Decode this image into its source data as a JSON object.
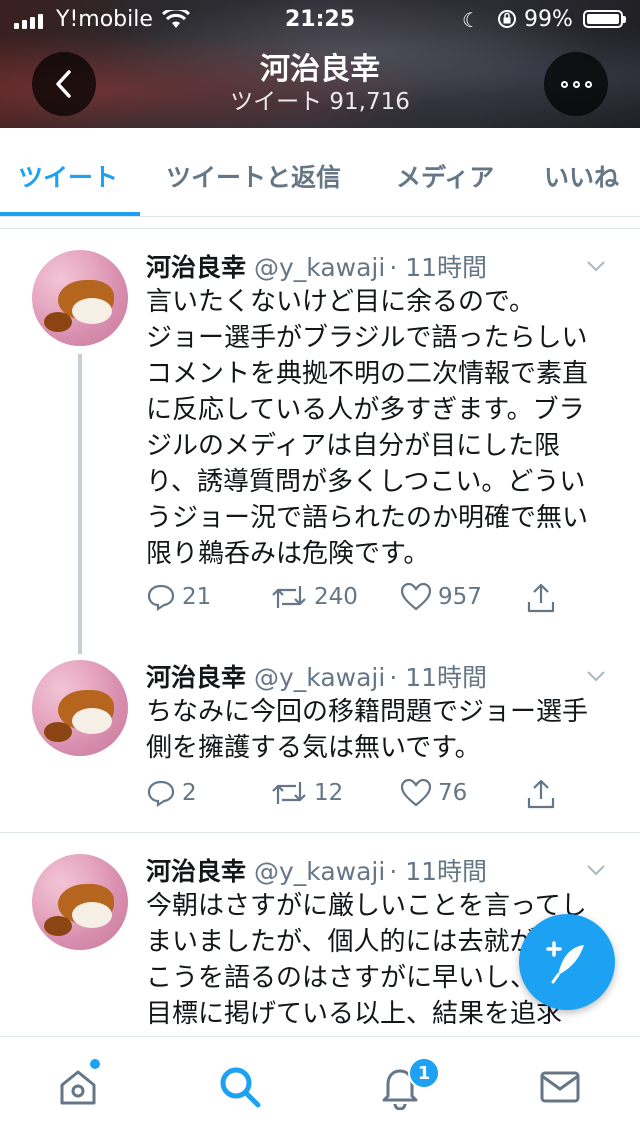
{
  "status_bar": {
    "carrier": "Y!mobile",
    "time": "21:25",
    "battery": "99%"
  },
  "header": {
    "title": "河治良幸",
    "subtitle": "ツイート 91,716"
  },
  "tabs": [
    {
      "label": "ツイート",
      "active": true
    },
    {
      "label": "ツイートと返信",
      "active": false
    },
    {
      "label": "メディア",
      "active": false
    },
    {
      "label": "いいね",
      "active": false
    }
  ],
  "tweets": [
    {
      "name": "河治良幸",
      "handle": "@y_kawaji",
      "time": "· 11時間",
      "text": "言いたくないけど目に余るので。\nジョー選手がブラジルで語ったらしいコメントを典拠不明の二次情報で素直に反応している人が多すぎます。ブラジルのメディアは自分が目にした限り、誘導質問が多くしつこい。どういうジョー況で語られたのか明確で無い限り鵜呑みは危険です。",
      "replies": "21",
      "retweets": "240",
      "likes": "957"
    },
    {
      "name": "河治良幸",
      "handle": "@y_kawaji",
      "time": "· 11時間",
      "text": "ちなみに今回の移籍問題でジョー選手側を擁護する気は無いです。",
      "replies": "2",
      "retweets": "12",
      "likes": "76"
    },
    {
      "name": "河治良幸",
      "handle": "@y_kawaji",
      "time": "· 11時間",
      "text": "今朝はさすがに厳しいことを言ってしまいましたが、個人的には去就がどうこうを語るのはさすがに早いし、J1を目標に掲げている以上、結果を追求"
    }
  ],
  "bottom_nav": {
    "notifications_badge": "1"
  },
  "colors": {
    "accent": "#1da1f2",
    "muted": "#657786"
  }
}
